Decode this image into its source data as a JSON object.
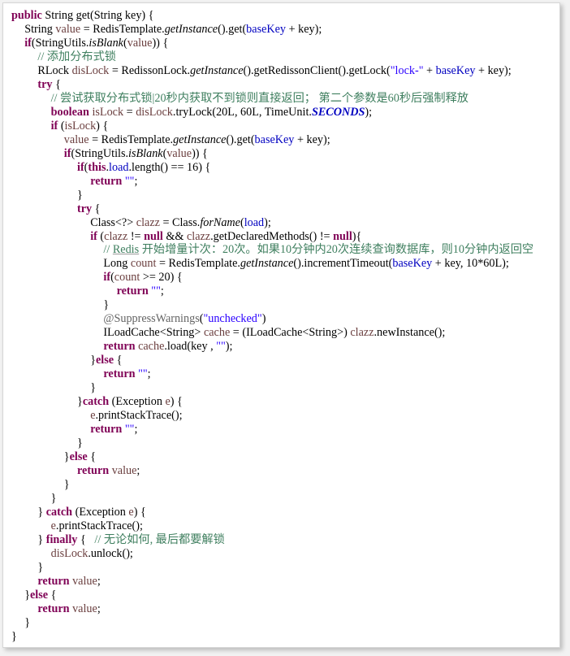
{
  "code_lines": [
    {
      "indent": 0,
      "tokens": [
        {
          "t": "public",
          "c": "kw"
        },
        {
          "t": " String get(String key) {"
        }
      ]
    },
    {
      "indent": 1,
      "tokens": [
        {
          "t": "String "
        },
        {
          "t": "value",
          "c": "var"
        },
        {
          "t": " = RedisTemplate."
        },
        {
          "t": "getInstance",
          "c": "it"
        },
        {
          "t": "().get("
        },
        {
          "t": "baseKey",
          "c": "fld"
        },
        {
          "t": " + key);"
        }
      ]
    },
    {
      "indent": 1,
      "tokens": [
        {
          "t": "if",
          "c": "kw"
        },
        {
          "t": "(StringUtils."
        },
        {
          "t": "isBlank",
          "c": "it"
        },
        {
          "t": "("
        },
        {
          "t": "value",
          "c": "var"
        },
        {
          "t": ")) {"
        }
      ]
    },
    {
      "indent": 2,
      "tokens": [
        {
          "t": "// 添加分布式锁",
          "c": "cmt"
        }
      ]
    },
    {
      "indent": 2,
      "tokens": [
        {
          "t": "RLock "
        },
        {
          "t": "disLock",
          "c": "var"
        },
        {
          "t": " = RedissonLock."
        },
        {
          "t": "getInstance",
          "c": "it"
        },
        {
          "t": "().getRedissonClient().getLock("
        },
        {
          "t": "\"lock-\"",
          "c": "str"
        },
        {
          "t": " + "
        },
        {
          "t": "baseKey",
          "c": "fld"
        },
        {
          "t": " + key);"
        }
      ]
    },
    {
      "indent": 2,
      "tokens": [
        {
          "t": "try",
          "c": "kw"
        },
        {
          "t": " {"
        }
      ]
    },
    {
      "indent": 3,
      "tokens": [
        {
          "t": "// 尝试获取分布式锁|20秒内获取不到锁则直接返回； 第二个参数是60秒后强制释放",
          "c": "cmt"
        }
      ]
    },
    {
      "indent": 3,
      "tokens": [
        {
          "t": "boolean",
          "c": "kw"
        },
        {
          "t": " "
        },
        {
          "t": "isLock",
          "c": "var"
        },
        {
          "t": " = "
        },
        {
          "t": "disLock",
          "c": "var"
        },
        {
          "t": ".tryLock(20L, 60L, TimeUnit."
        },
        {
          "t": "SECONDS",
          "c": "sc"
        },
        {
          "t": ");"
        }
      ]
    },
    {
      "indent": 3,
      "tokens": [
        {
          "t": "if",
          "c": "kw"
        },
        {
          "t": " ("
        },
        {
          "t": "isLock",
          "c": "var"
        },
        {
          "t": ") {"
        }
      ]
    },
    {
      "indent": 4,
      "tokens": [
        {
          "t": "value",
          "c": "var"
        },
        {
          "t": " = RedisTemplate."
        },
        {
          "t": "getInstance",
          "c": "it"
        },
        {
          "t": "().get("
        },
        {
          "t": "baseKey",
          "c": "fld"
        },
        {
          "t": " + key);"
        }
      ]
    },
    {
      "indent": 4,
      "tokens": [
        {
          "t": "if",
          "c": "kw"
        },
        {
          "t": "(StringUtils."
        },
        {
          "t": "isBlank",
          "c": "it"
        },
        {
          "t": "("
        },
        {
          "t": "value",
          "c": "var"
        },
        {
          "t": ")) {"
        }
      ]
    },
    {
      "indent": 5,
      "tokens": [
        {
          "t": "if",
          "c": "kw"
        },
        {
          "t": "("
        },
        {
          "t": "this",
          "c": "kw"
        },
        {
          "t": "."
        },
        {
          "t": "load",
          "c": "fld"
        },
        {
          "t": ".length() == 16) {"
        }
      ]
    },
    {
      "indent": 6,
      "tokens": [
        {
          "t": "return",
          "c": "kw"
        },
        {
          "t": " "
        },
        {
          "t": "\"\"",
          "c": "str"
        },
        {
          "t": ";"
        }
      ]
    },
    {
      "indent": 5,
      "tokens": [
        {
          "t": "}"
        }
      ]
    },
    {
      "indent": 5,
      "tokens": [
        {
          "t": "try",
          "c": "kw"
        },
        {
          "t": " {"
        }
      ]
    },
    {
      "indent": 6,
      "tokens": [
        {
          "t": "Class<?> "
        },
        {
          "t": "clazz",
          "c": "var"
        },
        {
          "t": " = Class."
        },
        {
          "t": "forName",
          "c": "it"
        },
        {
          "t": "("
        },
        {
          "t": "load",
          "c": "fld"
        },
        {
          "t": ");"
        }
      ]
    },
    {
      "indent": 6,
      "tokens": [
        {
          "t": "if",
          "c": "kw"
        },
        {
          "t": " ("
        },
        {
          "t": "clazz",
          "c": "var"
        },
        {
          "t": " != "
        },
        {
          "t": "null",
          "c": "kw"
        },
        {
          "t": " && "
        },
        {
          "t": "clazz",
          "c": "var"
        },
        {
          "t": ".getDeclaredMethods() != "
        },
        {
          "t": "null",
          "c": "kw"
        },
        {
          "t": "){"
        }
      ]
    },
    {
      "indent": 7,
      "tokens": [
        {
          "t": "// ",
          "c": "cmt"
        },
        {
          "t": "Redis",
          "c": "cmt ul"
        },
        {
          "t": " 开始增量计次：20次。如果10分钟内20次连续查询数据库，则10分钟内返回空",
          "c": "cmt"
        }
      ]
    },
    {
      "indent": 7,
      "tokens": [
        {
          "t": "Long "
        },
        {
          "t": "count",
          "c": "var"
        },
        {
          "t": " = RedisTemplate."
        },
        {
          "t": "getInstance",
          "c": "it"
        },
        {
          "t": "().incrementTimeout("
        },
        {
          "t": "baseKey",
          "c": "fld"
        },
        {
          "t": " + key, 10*60L);"
        }
      ]
    },
    {
      "indent": 7,
      "tokens": [
        {
          "t": "if",
          "c": "kw"
        },
        {
          "t": "("
        },
        {
          "t": "count",
          "c": "var"
        },
        {
          "t": " >= 20) {"
        }
      ]
    },
    {
      "indent": 8,
      "tokens": [
        {
          "t": "return",
          "c": "kw"
        },
        {
          "t": " "
        },
        {
          "t": "\"\"",
          "c": "str"
        },
        {
          "t": ";"
        }
      ]
    },
    {
      "indent": 7,
      "tokens": [
        {
          "t": "}"
        }
      ]
    },
    {
      "indent": 7,
      "tokens": [
        {
          "t": "@SuppressWarnings",
          "c": "ann"
        },
        {
          "t": "("
        },
        {
          "t": "\"unchecked\"",
          "c": "str"
        },
        {
          "t": ")"
        }
      ]
    },
    {
      "indent": 7,
      "tokens": [
        {
          "t": "ILoadCache<String> "
        },
        {
          "t": "cache",
          "c": "var"
        },
        {
          "t": " = (ILoadCache<String>) "
        },
        {
          "t": "clazz",
          "c": "var"
        },
        {
          "t": ".newInstance();"
        }
      ]
    },
    {
      "indent": 7,
      "tokens": [
        {
          "t": "return",
          "c": "kw"
        },
        {
          "t": " "
        },
        {
          "t": "cache",
          "c": "var"
        },
        {
          "t": ".load(key , "
        },
        {
          "t": "\"\"",
          "c": "str"
        },
        {
          "t": ");"
        }
      ]
    },
    {
      "indent": 6,
      "tokens": [
        {
          "t": "}"
        },
        {
          "t": "else",
          "c": "kw"
        },
        {
          "t": " {"
        }
      ]
    },
    {
      "indent": 7,
      "tokens": [
        {
          "t": "return",
          "c": "kw"
        },
        {
          "t": " "
        },
        {
          "t": "\"\"",
          "c": "str"
        },
        {
          "t": ";"
        }
      ]
    },
    {
      "indent": 6,
      "tokens": [
        {
          "t": "}"
        }
      ]
    },
    {
      "indent": 5,
      "tokens": [
        {
          "t": "}"
        },
        {
          "t": "catch",
          "c": "kw"
        },
        {
          "t": " (Exception "
        },
        {
          "t": "e",
          "c": "var"
        },
        {
          "t": ") {"
        }
      ]
    },
    {
      "indent": 6,
      "tokens": [
        {
          "t": "e",
          "c": "var"
        },
        {
          "t": ".printStackTrace();"
        }
      ]
    },
    {
      "indent": 6,
      "tokens": [
        {
          "t": "return",
          "c": "kw"
        },
        {
          "t": " "
        },
        {
          "t": "\"\"",
          "c": "str"
        },
        {
          "t": ";"
        }
      ]
    },
    {
      "indent": 5,
      "tokens": [
        {
          "t": "}"
        }
      ]
    },
    {
      "indent": 4,
      "tokens": [
        {
          "t": "}"
        },
        {
          "t": "else",
          "c": "kw"
        },
        {
          "t": " {"
        }
      ]
    },
    {
      "indent": 5,
      "tokens": [
        {
          "t": "return",
          "c": "kw"
        },
        {
          "t": " "
        },
        {
          "t": "value",
          "c": "var"
        },
        {
          "t": ";"
        }
      ]
    },
    {
      "indent": 4,
      "tokens": [
        {
          "t": "}"
        }
      ]
    },
    {
      "indent": 3,
      "tokens": [
        {
          "t": "}"
        }
      ]
    },
    {
      "indent": 2,
      "tokens": [
        {
          "t": "} "
        },
        {
          "t": "catch",
          "c": "kw"
        },
        {
          "t": " (Exception "
        },
        {
          "t": "e",
          "c": "var"
        },
        {
          "t": ") {"
        }
      ]
    },
    {
      "indent": 3,
      "tokens": [
        {
          "t": "e",
          "c": "var"
        },
        {
          "t": ".printStackTrace();"
        }
      ]
    },
    {
      "indent": 2,
      "tokens": [
        {
          "t": "} "
        },
        {
          "t": "finally",
          "c": "kw"
        },
        {
          "t": " {   "
        },
        {
          "t": "// 无论如何, 最后都要解锁",
          "c": "cmt"
        }
      ]
    },
    {
      "indent": 3,
      "tokens": [
        {
          "t": "disLock",
          "c": "var"
        },
        {
          "t": ".unlock();"
        }
      ]
    },
    {
      "indent": 2,
      "tokens": [
        {
          "t": "}"
        }
      ]
    },
    {
      "indent": 2,
      "tokens": [
        {
          "t": "return",
          "c": "kw"
        },
        {
          "t": " "
        },
        {
          "t": "value",
          "c": "var"
        },
        {
          "t": ";"
        }
      ]
    },
    {
      "indent": 1,
      "tokens": [
        {
          "t": "}"
        },
        {
          "t": "else",
          "c": "kw"
        },
        {
          "t": " {"
        }
      ]
    },
    {
      "indent": 2,
      "tokens": [
        {
          "t": "return",
          "c": "kw"
        },
        {
          "t": " "
        },
        {
          "t": "value",
          "c": "var"
        },
        {
          "t": ";"
        }
      ]
    },
    {
      "indent": 1,
      "tokens": [
        {
          "t": "}"
        }
      ]
    },
    {
      "indent": 0,
      "tokens": [
        {
          "t": "}"
        }
      ]
    }
  ]
}
